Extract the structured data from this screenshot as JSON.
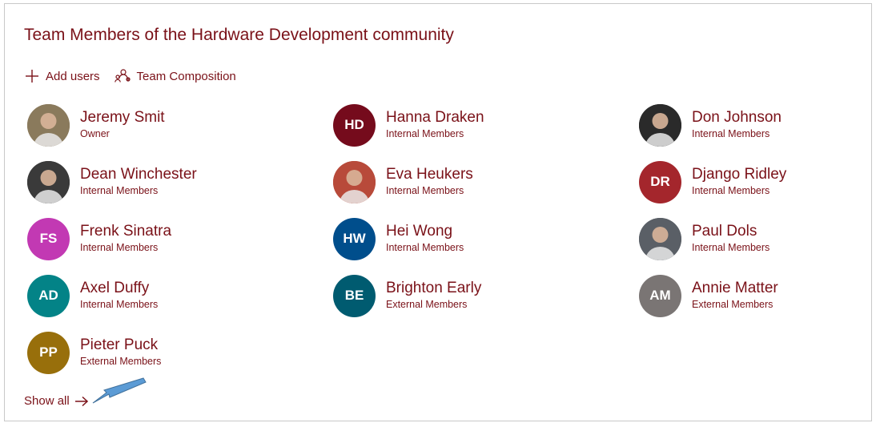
{
  "card": {
    "title": "Team Members of the Hardware Development community"
  },
  "toolbar": {
    "add_users_label": "Add users",
    "add_users_icon": "plus-icon",
    "team_composition_label": "Team Composition",
    "team_composition_icon": "people-org-icon"
  },
  "members": [
    {
      "name": "Jeremy Smit",
      "role": "Owner",
      "initials": "",
      "color": "#8a7a5c",
      "photo": true
    },
    {
      "name": "Hanna Draken",
      "role": "Internal Members",
      "initials": "HD",
      "color": "#750b1c",
      "photo": false
    },
    {
      "name": "Don Johnson",
      "role": "Internal Members",
      "initials": "",
      "color": "#2a2a2a",
      "photo": true
    },
    {
      "name": "Dean Winchester",
      "role": "Internal Members",
      "initials": "",
      "color": "#3a3a3a",
      "photo": true
    },
    {
      "name": "Eva Heukers",
      "role": "Internal Members",
      "initials": "",
      "color": "#b84a3a",
      "photo": true
    },
    {
      "name": "Django Ridley",
      "role": "Internal Members",
      "initials": "DR",
      "color": "#a4262c",
      "photo": false
    },
    {
      "name": "Frenk Sinatra",
      "role": "Internal Members",
      "initials": "FS",
      "color": "#c239b3",
      "photo": false
    },
    {
      "name": "Hei Wong",
      "role": "Internal Members",
      "initials": "HW",
      "color": "#004e8c",
      "photo": false
    },
    {
      "name": "Paul Dols",
      "role": "Internal Members",
      "initials": "",
      "color": "#5a5f66",
      "photo": true
    },
    {
      "name": "Axel Duffy",
      "role": "Internal Members",
      "initials": "AD",
      "color": "#038387",
      "photo": false
    },
    {
      "name": "Brighton Early",
      "role": "External Members",
      "initials": "BE",
      "color": "#005b70",
      "photo": false
    },
    {
      "name": "Annie Matter",
      "role": "External Members",
      "initials": "AM",
      "color": "#7a7574",
      "photo": false
    },
    {
      "name": "Pieter Puck",
      "role": "External Members",
      "initials": "PP",
      "color": "#986f0b",
      "photo": false
    }
  ],
  "footer": {
    "show_all_label": "Show all",
    "show_all_icon": "arrow-right-icon"
  },
  "colors": {
    "accent": "#7a1118",
    "callout_arrow": "#5b9bd5"
  }
}
